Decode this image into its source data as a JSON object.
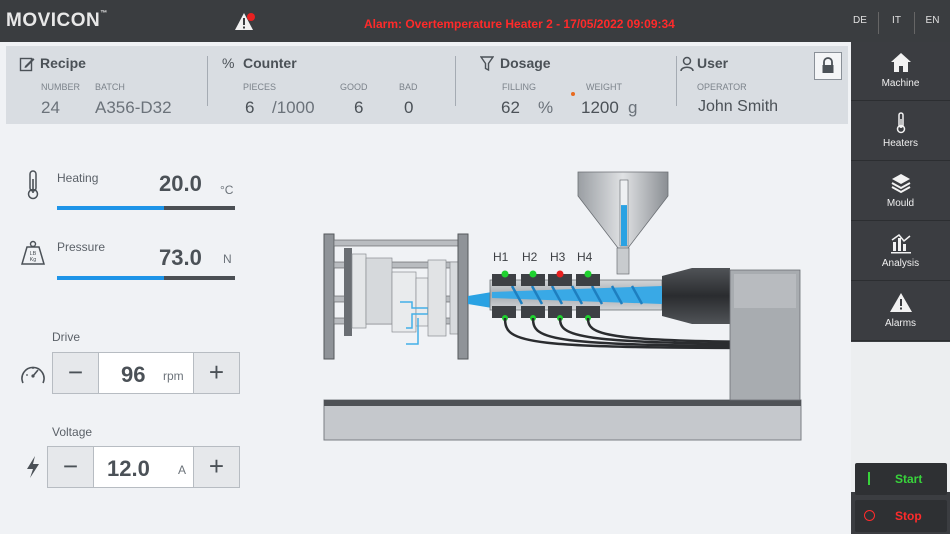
{
  "app": {
    "logo": "MOVICON",
    "logo_tm": "™"
  },
  "alarm_banner": "Alarm: Overtemperature Heater 2 - 17/05/2022 09:09:34",
  "languages": [
    "DE",
    "IT",
    "EN"
  ],
  "nav": [
    {
      "label": "Machine",
      "icon": "home-icon"
    },
    {
      "label": "Heaters",
      "icon": "thermometer-icon"
    },
    {
      "label": "Mould",
      "icon": "layers-icon"
    },
    {
      "label": "Analysis",
      "icon": "chart-icon"
    },
    {
      "label": "Alarms",
      "icon": "warning-icon"
    }
  ],
  "actions": {
    "start": "Start",
    "stop": "Stop"
  },
  "colors": {
    "accent": "#1e94e8",
    "alarm": "#ff2a2a",
    "start": "#38d33b",
    "ok_led": "#1fd12f",
    "fault_led": "#e81f1f"
  },
  "recipe": {
    "title": "Recipe",
    "number_label": "NUMBER",
    "number": "24",
    "batch_label": "BATCH",
    "batch": "A356-D32"
  },
  "counter": {
    "title": "Counter",
    "icon_text": "%",
    "pieces_label": "PIECES",
    "pieces": "6",
    "total": "/1000",
    "good_label": "GOOD",
    "good": "6",
    "bad_label": "BAD",
    "bad": "0"
  },
  "dosage": {
    "title": "Dosage",
    "filling_label": "FILLING",
    "filling": "62",
    "filling_unit": "%",
    "weight_label": "WEIGHT",
    "weight": "1200",
    "weight_unit": "g"
  },
  "user": {
    "title": "User",
    "operator_label": "OPERATOR",
    "operator": "John Smith"
  },
  "heating": {
    "label": "Heating",
    "value": "20.0",
    "unit": "°C",
    "level": 0.6
  },
  "pressure": {
    "label": "Pressure",
    "value": "73.0",
    "unit": "N",
    "level": 0.6,
    "icon_text_top": "LB",
    "icon_text_bottom": "Kg"
  },
  "drive": {
    "label": "Drive",
    "value": "96",
    "unit": "rpm"
  },
  "voltage": {
    "label": "Voltage",
    "value": "12.0",
    "unit": "A"
  },
  "heaters": [
    {
      "label": "H1",
      "status": "ok"
    },
    {
      "label": "H2",
      "status": "ok"
    },
    {
      "label": "H3",
      "status": "fault"
    },
    {
      "label": "H4",
      "status": "ok"
    }
  ]
}
